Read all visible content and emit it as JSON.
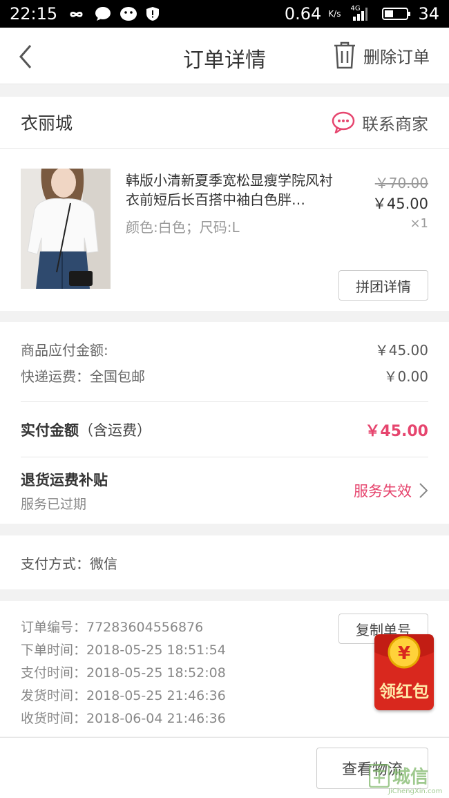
{
  "status_bar": {
    "time": "22:15",
    "speed": "0.64",
    "speed_unit": "K/s",
    "network": "4G",
    "battery": "34"
  },
  "nav": {
    "title": "订单详情",
    "delete_label": "删除订单"
  },
  "shop": {
    "name": "衣丽城",
    "contact_label": "联系商家"
  },
  "item": {
    "title": "韩版小清新夏季宽松显瘦学院风衬衣前短后长百搭中袖白色胖…",
    "spec": "颜色:白色；尺码:L",
    "price_original": "￥70.00",
    "price_current": "￥45.00",
    "quantity": "×1",
    "group_button": "拼团详情"
  },
  "amounts": {
    "goods_label": "商品应付金额:",
    "goods_value": "￥45.00",
    "shipping_label": "快递运费：全国包邮",
    "shipping_value": "￥0.00",
    "paid_label": "实付金额",
    "paid_note": "（含运费）",
    "paid_value": "￥45.00",
    "subsidy_title": "退货运费补贴",
    "subsidy_sub": "服务已过期",
    "subsidy_status": "服务失效"
  },
  "payment": {
    "label": "支付方式：微信"
  },
  "order_info": {
    "order_no": "订单编号：77283604556876",
    "order_time": "下单时间：2018-05-25  18:51:54",
    "pay_time": "支付时间：2018-05-25  18:52:08",
    "ship_time": "发货时间：2018-05-25  21:46:36",
    "receive_time": "收货时间：2018-06-04  21:46:36",
    "copy_button": "复制单号"
  },
  "bottom": {
    "logistics_button": "查看物流"
  },
  "redpacket": {
    "label": "领红包",
    "coin_symbol": "¥"
  },
  "watermark": {
    "text": "城信",
    "url": "JiChengXin.com"
  },
  "colors": {
    "accent_pink": "#e6456e",
    "redpacket": "#d9281e",
    "background": "#f2f2f2"
  }
}
